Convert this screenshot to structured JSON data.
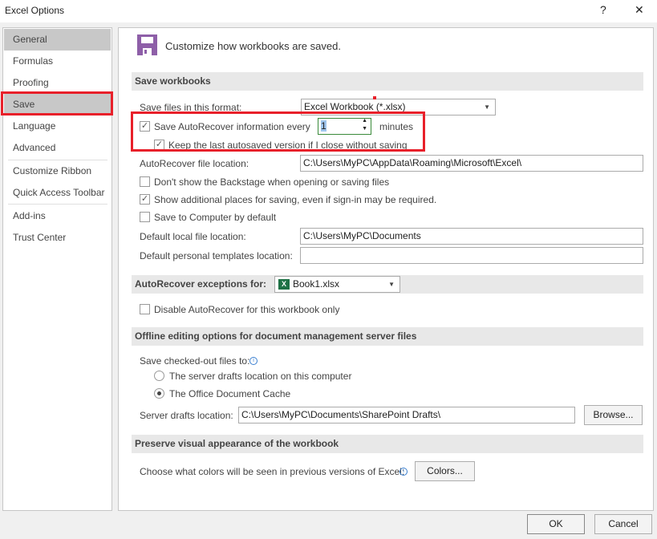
{
  "window": {
    "title": "Excel Options",
    "help": "?",
    "close": "✕"
  },
  "sidebar": {
    "items": [
      {
        "label": "General"
      },
      {
        "label": "Formulas"
      },
      {
        "label": "Proofing"
      },
      {
        "label": "Save"
      },
      {
        "label": "Language"
      },
      {
        "label": "Advanced"
      },
      {
        "label": "Customize Ribbon"
      },
      {
        "label": "Quick Access Toolbar"
      },
      {
        "label": "Add-ins"
      },
      {
        "label": "Trust Center"
      }
    ]
  },
  "header": {
    "title": "Customize how workbooks are saved."
  },
  "save_workbooks": {
    "heading": "Save workbooks",
    "format_label": "Save files in this format:",
    "format_value": "Excel Workbook (*.xlsx)",
    "autorecover_label": "Save AutoRecover information every",
    "autorecover_minutes": "1",
    "minutes_label": "minutes",
    "keep_last_label": "Keep the last autosaved version if I close without saving",
    "autorecover_location_label": "AutoRecover file location:",
    "autorecover_location": "C:\\Users\\MyPC\\AppData\\Roaming\\Microsoft\\Excel\\",
    "backstage_label": "Don't show the Backstage when opening or saving files",
    "additional_places_label": "Show additional places for saving, even if sign-in may be required.",
    "save_computer_label": "Save to Computer by default",
    "default_local_label": "Default local file location:",
    "default_local": "C:\\Users\\MyPC\\Documents",
    "default_templates_label": "Default personal templates location:",
    "default_templates": ""
  },
  "exceptions": {
    "heading": "AutoRecover exceptions for:",
    "workbook": "Book1.xlsx",
    "disable_label": "Disable AutoRecover for this workbook only"
  },
  "offline": {
    "heading": "Offline editing options for document management server files",
    "save_to_label": "Save checked-out files to:",
    "option1": "The server drafts location on this computer",
    "option2": "The Office Document Cache",
    "drafts_label": "Server drafts location:",
    "drafts_value": "C:\\Users\\MyPC\\Documents\\SharePoint Drafts\\",
    "browse": "Browse..."
  },
  "preserve": {
    "heading": "Preserve visual appearance of the workbook",
    "colors_label": "Choose what colors will be seen in previous versions of Excel:",
    "colors_button": "Colors..."
  },
  "footer": {
    "ok": "OK",
    "cancel": "Cancel"
  },
  "colors": {
    "highlight": "#e8202a",
    "save_icon": "#8e5fa8"
  }
}
